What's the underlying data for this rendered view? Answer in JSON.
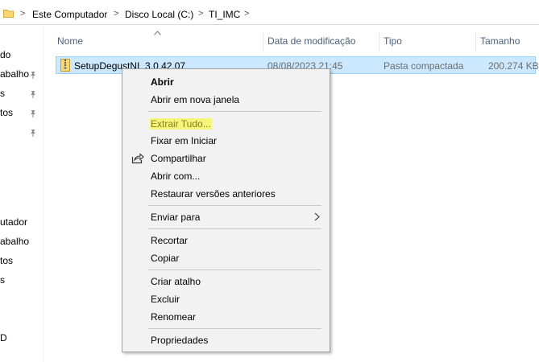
{
  "breadcrumb": {
    "items": [
      "Este Computador",
      "Disco Local (C:)",
      "TI_IMC"
    ],
    "separator": ">"
  },
  "nav": {
    "items": [
      "do",
      "abalho",
      "s",
      "tos",
      "utador",
      "abalho",
      "tos",
      "s",
      "D"
    ]
  },
  "columns": {
    "name": "Nome",
    "modified": "Data de modificação",
    "type": "Tipo",
    "size": "Tamanho"
  },
  "file": {
    "name": "SetupDegustNI_3.0.42.07",
    "modified": "08/08/2023 21:45",
    "type": "Pasta compactada",
    "size": "200.274 KB"
  },
  "context_menu": {
    "open": "Abrir",
    "open_new_window": "Abrir em nova janela",
    "extract_all": "Extrair Tudo...",
    "pin_start": "Fixar em Iniciar",
    "share": "Compartilhar",
    "open_with": "Abrir com...",
    "restore_versions": "Restaurar versões anteriores",
    "send_to": "Enviar para",
    "cut": "Recortar",
    "copy": "Copiar",
    "create_shortcut": "Criar atalho",
    "delete": "Excluir",
    "rename": "Renomear",
    "properties": "Propriedades"
  },
  "colors": {
    "selection_bg": "#cce8ff",
    "selection_border": "#99d1ff",
    "menu_bg": "#f2f2f2",
    "highlight": "#f5f57a",
    "header_text": "#4c607a"
  }
}
